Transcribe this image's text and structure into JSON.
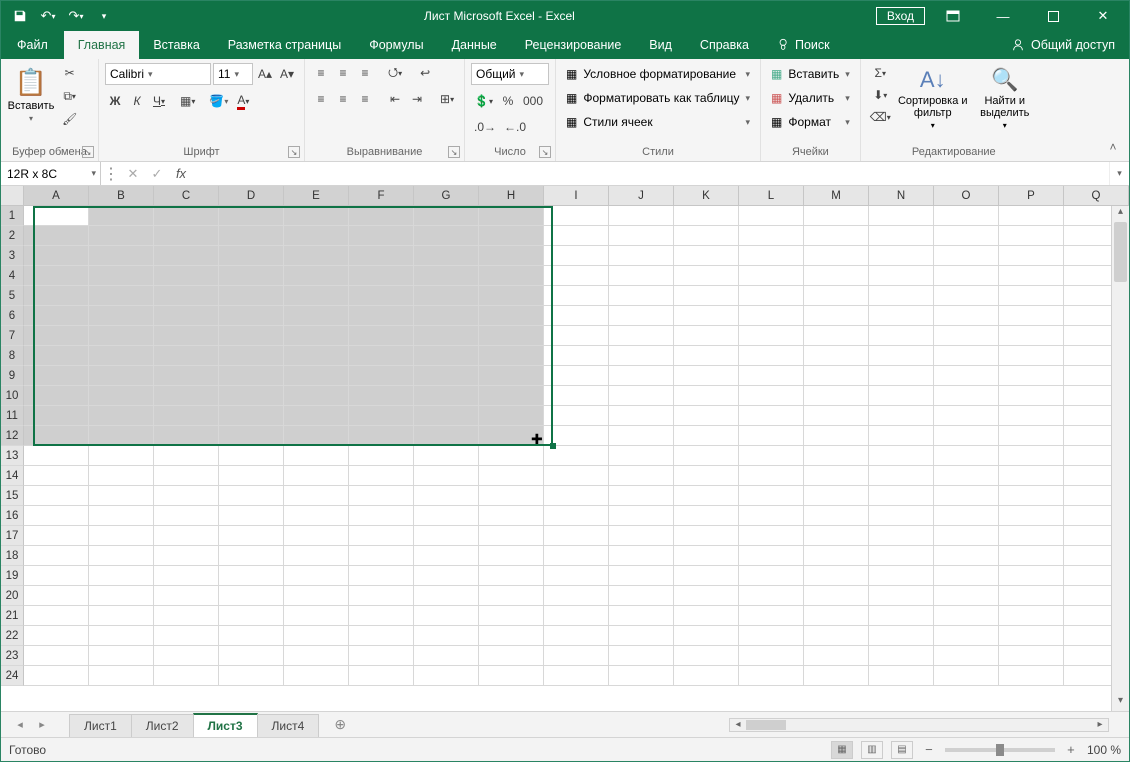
{
  "title": "Лист Microsoft Excel  -  Excel",
  "qat": {
    "save": "save-icon",
    "undo": "undo-icon",
    "redo": "redo-icon"
  },
  "login_button": "Вход",
  "tabs": {
    "file": "Файл",
    "home": "Главная",
    "insert": "Вставка",
    "pagelayout": "Разметка страницы",
    "formulas": "Формулы",
    "data": "Данные",
    "review": "Рецензирование",
    "view": "Вид",
    "help": "Справка",
    "tellme": "Поиск"
  },
  "share": "Общий доступ",
  "ribbon": {
    "clipboard": {
      "label": "Буфер обмена",
      "paste": "Вставить"
    },
    "font": {
      "label": "Шрифт",
      "name": "Calibri",
      "size": "11",
      "bold": "Ж",
      "italic": "К",
      "underline": "Ч"
    },
    "alignment": {
      "label": "Выравнивание"
    },
    "number": {
      "label": "Число",
      "format": "Общий"
    },
    "styles": {
      "label": "Стили",
      "cond": "Условное форматирование",
      "table": "Форматировать как таблицу",
      "cell": "Стили ячеек"
    },
    "cells": {
      "label": "Ячейки",
      "insert": "Вставить",
      "delete": "Удалить",
      "format": "Формат"
    },
    "editing": {
      "label": "Редактирование",
      "sort": "Сортировка и фильтр",
      "find": "Найти и выделить"
    }
  },
  "namebox": "12R x 8C",
  "formula_value": "",
  "columns": [
    "A",
    "B",
    "C",
    "D",
    "E",
    "F",
    "G",
    "H",
    "I",
    "J",
    "K",
    "L",
    "M",
    "N",
    "O",
    "P",
    "Q"
  ],
  "rows": [
    1,
    2,
    3,
    4,
    5,
    6,
    7,
    8,
    9,
    10,
    11,
    12,
    13,
    14,
    15,
    16,
    17,
    18,
    19,
    20,
    21,
    22,
    23,
    24
  ],
  "selection": {
    "cols": 8,
    "rows": 12
  },
  "sheets": [
    "Лист1",
    "Лист2",
    "Лист3",
    "Лист4"
  ],
  "active_sheet": 2,
  "status": "Готово",
  "zoom": "100 %"
}
